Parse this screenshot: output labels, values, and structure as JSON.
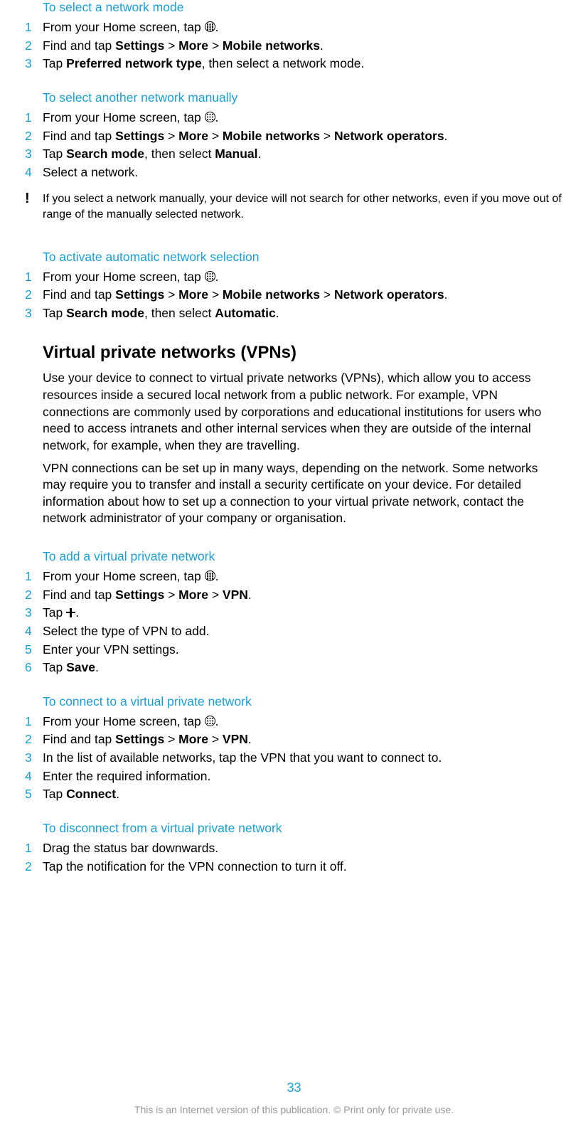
{
  "sec1": {
    "title": "To select a network mode",
    "s1a": "From your Home screen, tap ",
    "s1b": ".",
    "s2a": "Find and tap ",
    "s2b": "Settings",
    "s2c": " > ",
    "s2d": "More",
    "s2e": " > ",
    "s2f": "Mobile networks",
    "s2g": ".",
    "s3a": "Tap ",
    "s3b": "Preferred network type",
    "s3c": ", then select a network mode."
  },
  "sec2": {
    "title": "To select another network manually",
    "s1a": "From your Home screen, tap ",
    "s1b": ".",
    "s2a": "Find and tap ",
    "s2b": "Settings",
    "s2c": " > ",
    "s2d": "More",
    "s2e": " > ",
    "s2f": "Mobile networks",
    "s2g": " > ",
    "s2h": "Network operators",
    "s2i": ".",
    "s3a": "Tap ",
    "s3b": "Search mode",
    "s3c": ", then select ",
    "s3d": "Manual",
    "s3e": ".",
    "s4": "Select a network.",
    "note": "If you select a network manually, your device will not search for other networks, even if you move out of range of the manually selected network."
  },
  "sec3": {
    "title": "To activate automatic network selection",
    "s1a": "From your Home screen, tap ",
    "s1b": ".",
    "s2a": "Find and tap ",
    "s2b": "Settings",
    "s2c": " > ",
    "s2d": "More",
    "s2e": " > ",
    "s2f": "Mobile networks",
    "s2g": " > ",
    "s2h": "Network operators",
    "s2i": ".",
    "s3a": "Tap ",
    "s3b": "Search mode",
    "s3c": ", then select ",
    "s3d": "Automatic",
    "s3e": "."
  },
  "vpn": {
    "heading": "Virtual private networks (VPNs)",
    "p1": "Use your device to connect to virtual private networks (VPNs), which allow you to access resources inside a secured local network from a public network. For example, VPN connections are commonly used by corporations and educational institutions for users who need to access intranets and other internal services when they are outside of the internal network, for example, when they are travelling.",
    "p2": "VPN connections can be set up in many ways, depending on the network. Some networks may require you to transfer and install a security certificate on your device. For detailed information about how to set up a connection to your virtual private network, contact the network administrator of your company or organisation."
  },
  "sec4": {
    "title": "To add a virtual private network",
    "s1a": "From your Home screen, tap ",
    "s1b": ".",
    "s2a": "Find and tap ",
    "s2b": "Settings",
    "s2c": " > ",
    "s2d": "More",
    "s2e": " > ",
    "s2f": "VPN",
    "s2g": ".",
    "s3a": "Tap ",
    "s3b": ".",
    "s4": "Select the type of VPN to add.",
    "s5": "Enter your VPN settings.",
    "s6a": "Tap ",
    "s6b": "Save",
    "s6c": "."
  },
  "sec5": {
    "title": "To connect to a virtual private network",
    "s1a": "From your Home screen, tap ",
    "s1b": ".",
    "s2a": "Find and tap ",
    "s2b": "Settings",
    "s2c": " > ",
    "s2d": "More",
    "s2e": " > ",
    "s2f": "VPN",
    "s2g": ".",
    "s3": "In the list of available networks, tap the VPN that you want to connect to.",
    "s4": "Enter the required information.",
    "s5a": "Tap ",
    "s5b": "Connect",
    "s5c": "."
  },
  "sec6": {
    "title": "To disconnect from a virtual private network",
    "s1": "Drag the status bar downwards.",
    "s2": "Tap the notification for the VPN connection to turn it off."
  },
  "nums": {
    "n1": "1",
    "n2": "2",
    "n3": "3",
    "n4": "4",
    "n5": "5",
    "n6": "6"
  },
  "noteMark": "!",
  "pageNum": "33",
  "footer": "This is an Internet version of this publication. © Print only for private use."
}
